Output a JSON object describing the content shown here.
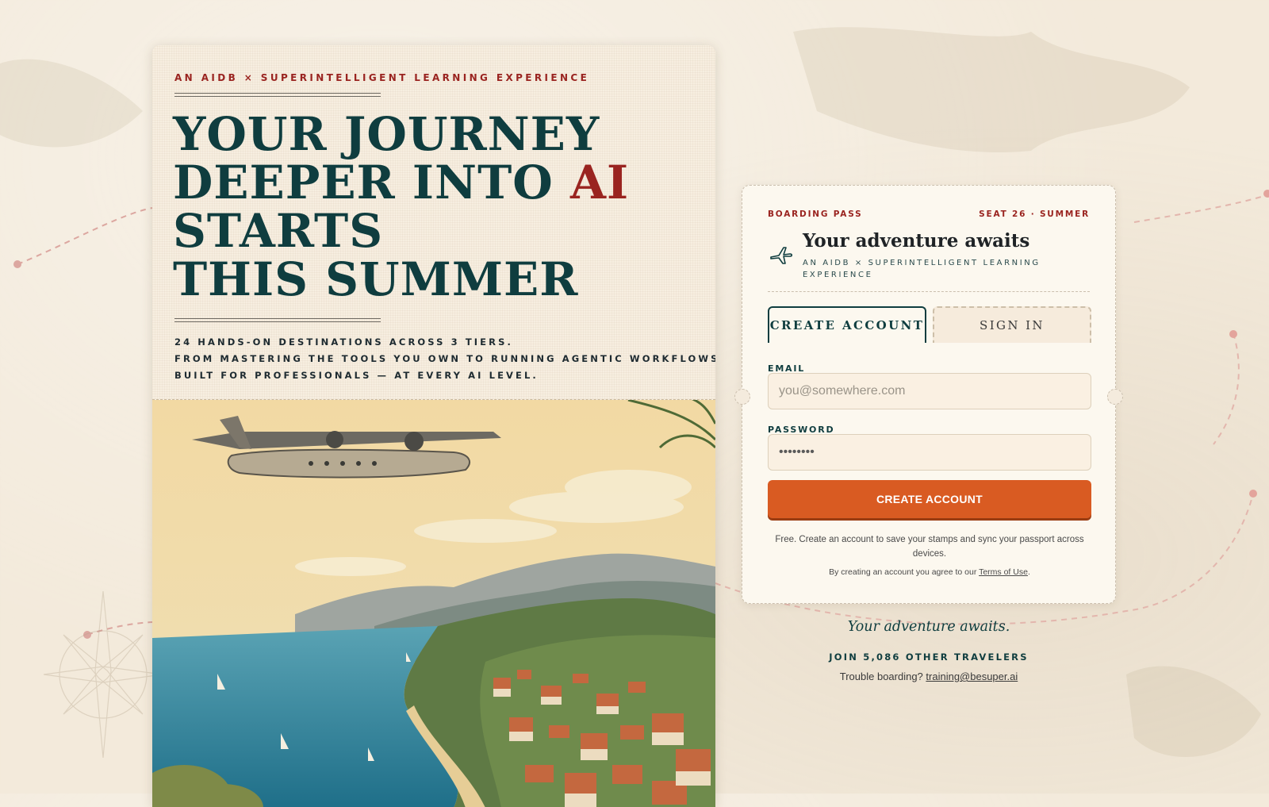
{
  "poster": {
    "eyebrow": "AN AIDB × SUPERINTELLIGENT LEARNING EXPERIENCE",
    "headline": {
      "line1": "YOUR JOURNEY",
      "line2_prefix": "DEEPER INTO ",
      "line2_accent": "AI",
      "line3": "STARTS",
      "line4": "THIS SUMMER"
    },
    "subtext": [
      "24 HANDS-ON DESTINATIONS ACROSS 3 TIERS.",
      "FROM MASTERING THE TOOLS YOU OWN TO RUNNING AGENTIC WORKFLOWS.",
      "BUILT FOR PROFESSIONALS — AT EVERY AI LEVEL."
    ]
  },
  "ticket": {
    "label_left": "BOARDING PASS",
    "label_right": "SEAT 26 · SUMMER",
    "title": "Your adventure awaits",
    "subtitle": "AN AIDB × SUPERINTELLIGENT LEARNING EXPERIENCE",
    "tabs": [
      {
        "label": "CREATE ACCOUNT",
        "active": true
      },
      {
        "label": "SIGN IN",
        "active": false
      }
    ],
    "email": {
      "label": "EMAIL",
      "placeholder": "you@somewhere.com",
      "value": ""
    },
    "password": {
      "label": "PASSWORD",
      "value": "••••••••"
    },
    "submit_label": "CREATE ACCOUNT",
    "fine_print": "Free. Create an account to save your stamps and sync your passport across devices.",
    "terms_prefix": "By creating an account you agree to our ",
    "terms_link": "Terms of Use",
    "terms_suffix": "."
  },
  "footer": {
    "tagline": "Your adventure awaits.",
    "travelers": "JOIN 5,086 OTHER TRAVELERS",
    "help_prefix": "Trouble boarding? ",
    "help_email": "training@besuper.ai"
  },
  "colors": {
    "teal": "#0f3d3f",
    "crimson": "#9a2420",
    "orange": "#d95b22",
    "paper": "#f3eadb"
  },
  "icons": {
    "ticket_icon": "airplane-icon",
    "map_decor": "compass-rose-icon"
  }
}
